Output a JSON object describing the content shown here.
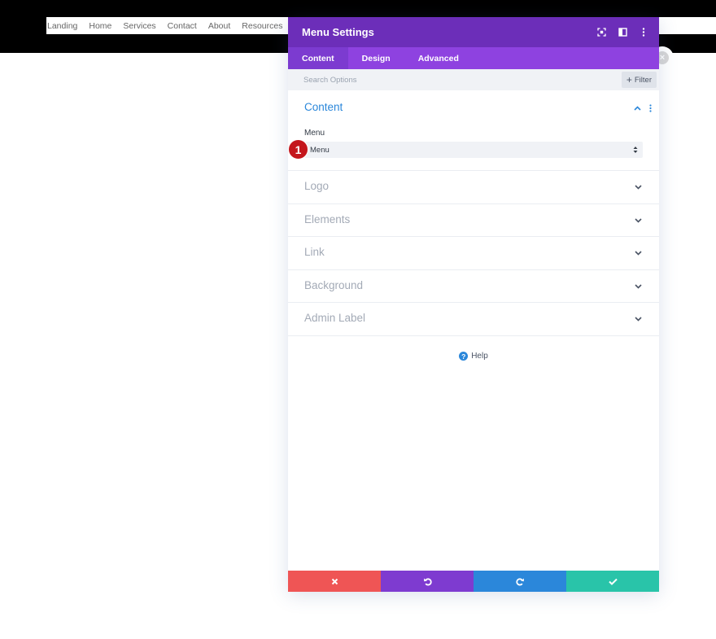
{
  "site_nav": {
    "links": [
      "Landing",
      "Home",
      "Services",
      "Contact",
      "About",
      "Resources"
    ]
  },
  "modal": {
    "title": "Menu Settings",
    "tabs": [
      "Content",
      "Design",
      "Advanced"
    ],
    "active_tab": "Content",
    "search_placeholder": "Search Options",
    "filter_label": "Filter",
    "content_section": {
      "title": "Content",
      "field_label": "Menu",
      "select_value": "Menu",
      "badge_number": "1"
    },
    "sections": [
      "Logo",
      "Elements",
      "Link",
      "Background",
      "Admin Label"
    ],
    "help_label": "Help"
  },
  "colors": {
    "header": "#6c2eb9",
    "tabs": "#8e42e0",
    "accent_blue": "#2b87da",
    "cancel": "#ef5555",
    "undo": "#7e3bd0",
    "redo": "#2b87da",
    "save": "#29c4a9",
    "badge": "#c4161c"
  },
  "icons": {
    "header": [
      "fullscreen-icon",
      "split-view-icon",
      "more-vertical-icon"
    ],
    "footer": [
      "close-icon",
      "undo-icon",
      "redo-icon",
      "check-icon"
    ]
  }
}
